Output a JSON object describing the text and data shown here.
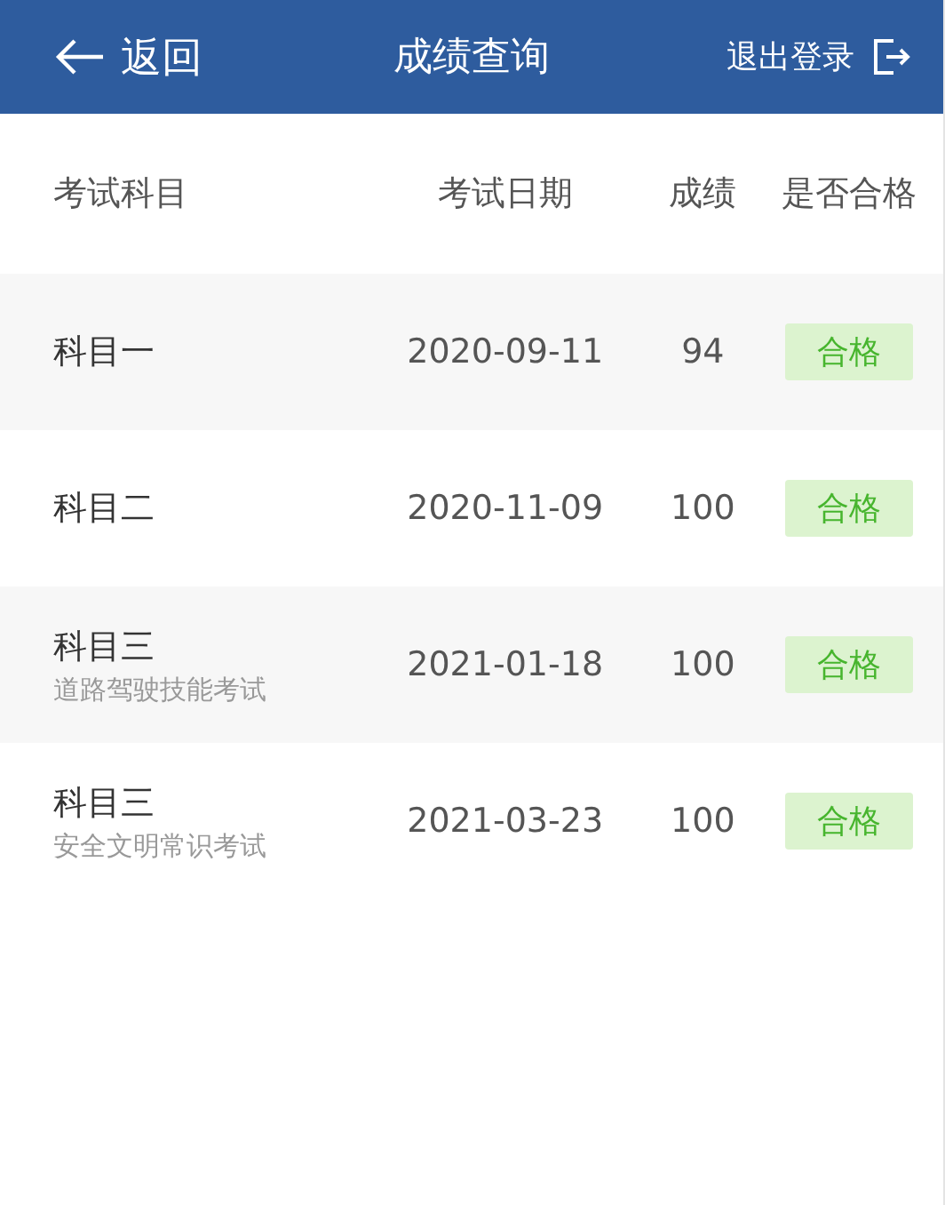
{
  "header": {
    "back_label": "返回",
    "title": "成绩查询",
    "logout_label": "退出登录"
  },
  "columns": [
    "考试科目",
    "考试日期",
    "成绩",
    "是否合格"
  ],
  "rows": [
    {
      "subject": "科目一",
      "date": "2020-09-11",
      "score": "94",
      "result": "合格",
      "passed": true
    },
    {
      "subject": "科目二",
      "date": "2020-11-09",
      "score": "100",
      "result": "合格",
      "passed": true
    },
    {
      "subject": "科目三",
      "subtitle": "道路驾驶技能考试",
      "date": "2021-01-18",
      "score": "100",
      "result": "合格",
      "passed": true
    },
    {
      "subject": "科目三",
      "subtitle": "安全文明常识考试",
      "date": "2021-03-23",
      "score": "100",
      "result": "合格",
      "passed": true
    }
  ]
}
